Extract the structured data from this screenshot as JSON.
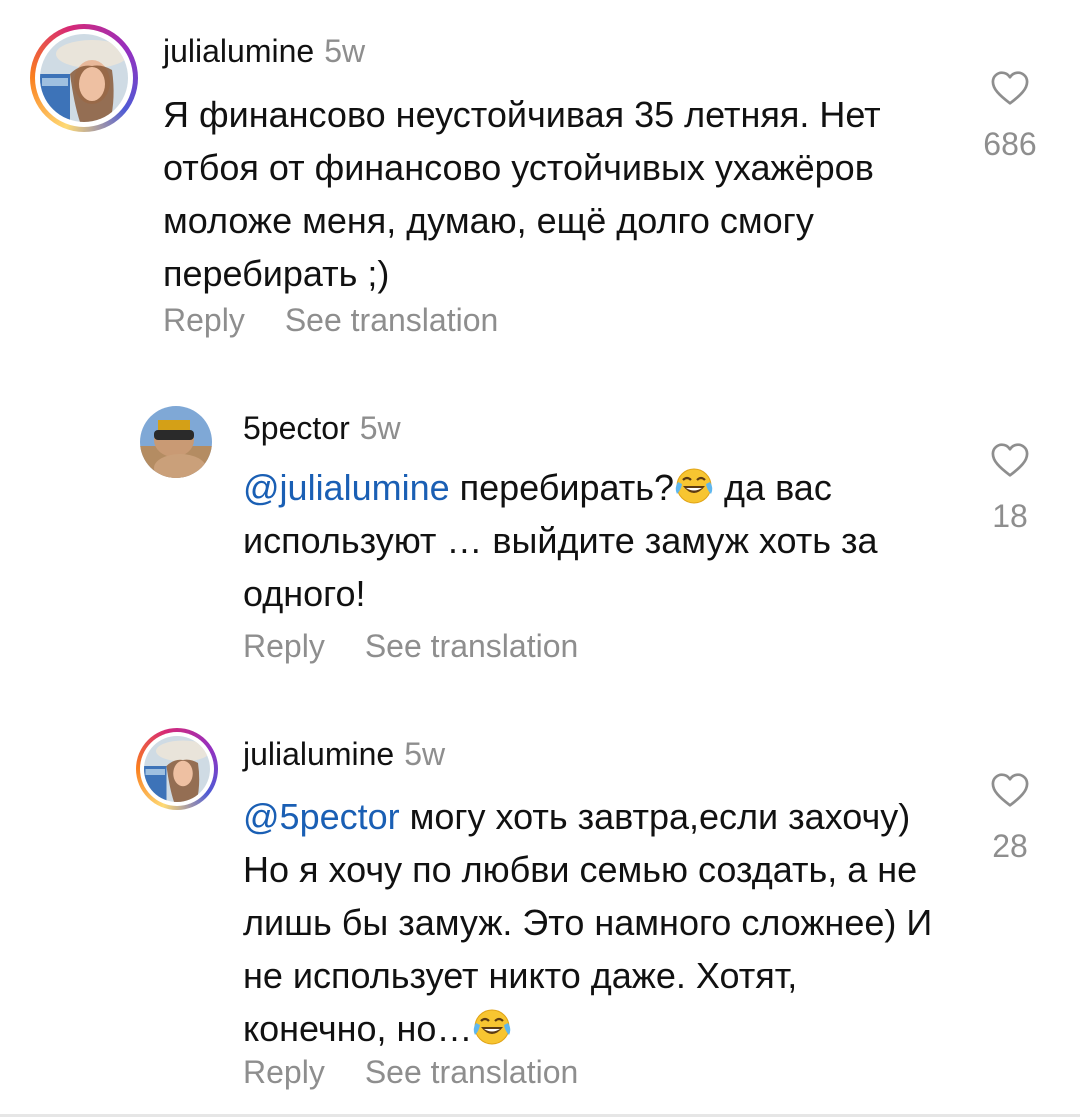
{
  "comments": [
    {
      "username": "julialumine",
      "time": "5w",
      "text": "Я финансово неустойчивая 35 летняя. Нет отбоя от финансово устойчивых ухажёров моложе меня, думаю, ещё долго смогу перебирать ;)",
      "likes": "686",
      "reply_label": "Reply",
      "translate_label": "See translation"
    },
    {
      "username": "5pector",
      "time": "5w",
      "mention": "@julialumine",
      "text_part1": " перебирать?",
      "emoji": "face-with-tears-of-joy",
      "text_part2": " да вас используют … выйдите замуж хоть за одного!",
      "likes": "18",
      "reply_label": "Reply",
      "translate_label": "See translation"
    },
    {
      "username": "julialumine",
      "time": "5w",
      "mention": "@5pector",
      "text_part1": " могу хоть завтра,если захочу) Но я хочу по любви семью создать, а не лишь бы замуж. Это намного сложнее)  И не использует никто даже. Хотят, конечно, но…",
      "emoji": "face-with-tears-of-joy",
      "likes": "28",
      "reply_label": "Reply",
      "translate_label": "See translation"
    }
  ],
  "colors": {
    "mention": "#1a5fb4",
    "secondary": "#8e8e8e",
    "text": "#111111"
  }
}
